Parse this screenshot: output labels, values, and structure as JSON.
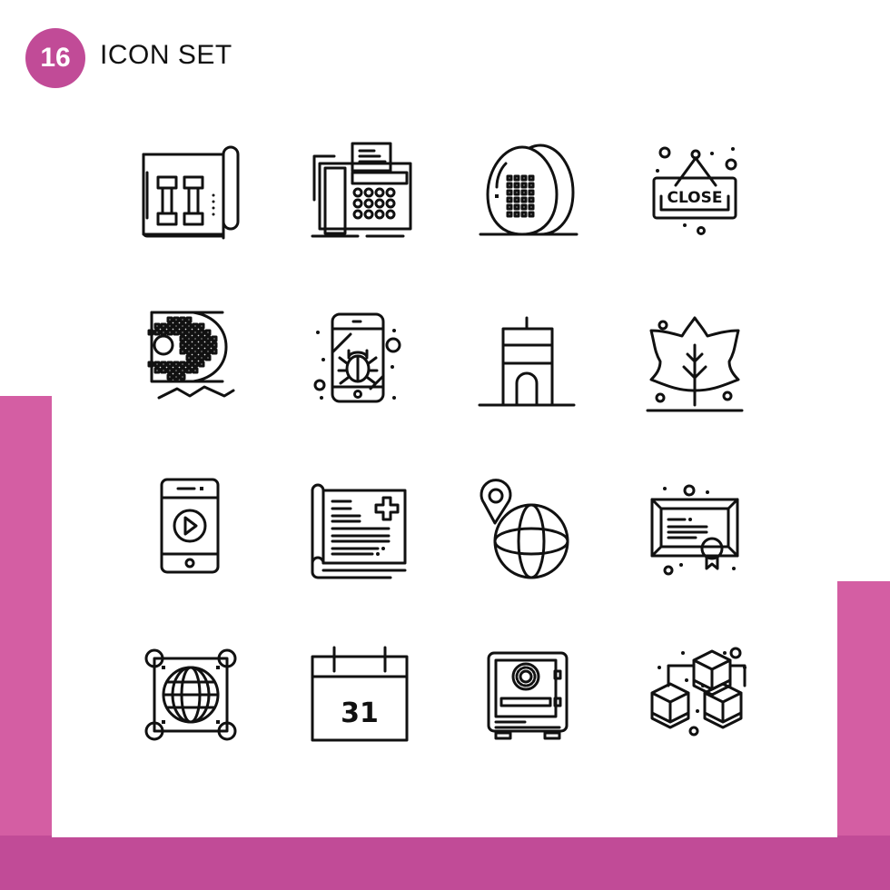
{
  "header": {
    "badge_number": "16",
    "title": "ICON SET"
  },
  "colors": {
    "accent": "#c14b97",
    "wave": "#d45ea3",
    "icon_stroke": "#111111",
    "card": "#ffffff"
  },
  "icons": [
    {
      "name": "dumbbell-blueprint-icon",
      "row": 1,
      "col": 1
    },
    {
      "name": "fax-machine-icon",
      "row": 1,
      "col": 2
    },
    {
      "name": "eggs-icon",
      "row": 1,
      "col": 3
    },
    {
      "name": "close-sign-icon",
      "row": 1,
      "col": 4,
      "label": "CLOSE"
    },
    {
      "name": "pixel-letter-d-icon",
      "row": 2,
      "col": 1
    },
    {
      "name": "mobile-bug-icon",
      "row": 2,
      "col": 2
    },
    {
      "name": "tower-building-icon",
      "row": 2,
      "col": 3
    },
    {
      "name": "maple-leaf-tree-icon",
      "row": 2,
      "col": 4
    },
    {
      "name": "mobile-video-play-icon",
      "row": 3,
      "col": 1
    },
    {
      "name": "medical-report-icon",
      "row": 3,
      "col": 2
    },
    {
      "name": "globe-location-pin-icon",
      "row": 3,
      "col": 3
    },
    {
      "name": "certificate-icon",
      "row": 3,
      "col": 4
    },
    {
      "name": "globe-selection-icon",
      "row": 4,
      "col": 1
    },
    {
      "name": "calendar-icon",
      "row": 4,
      "col": 2,
      "label": "31"
    },
    {
      "name": "safe-vault-icon",
      "row": 4,
      "col": 3
    },
    {
      "name": "blockchain-cubes-icon",
      "row": 4,
      "col": 4
    }
  ]
}
